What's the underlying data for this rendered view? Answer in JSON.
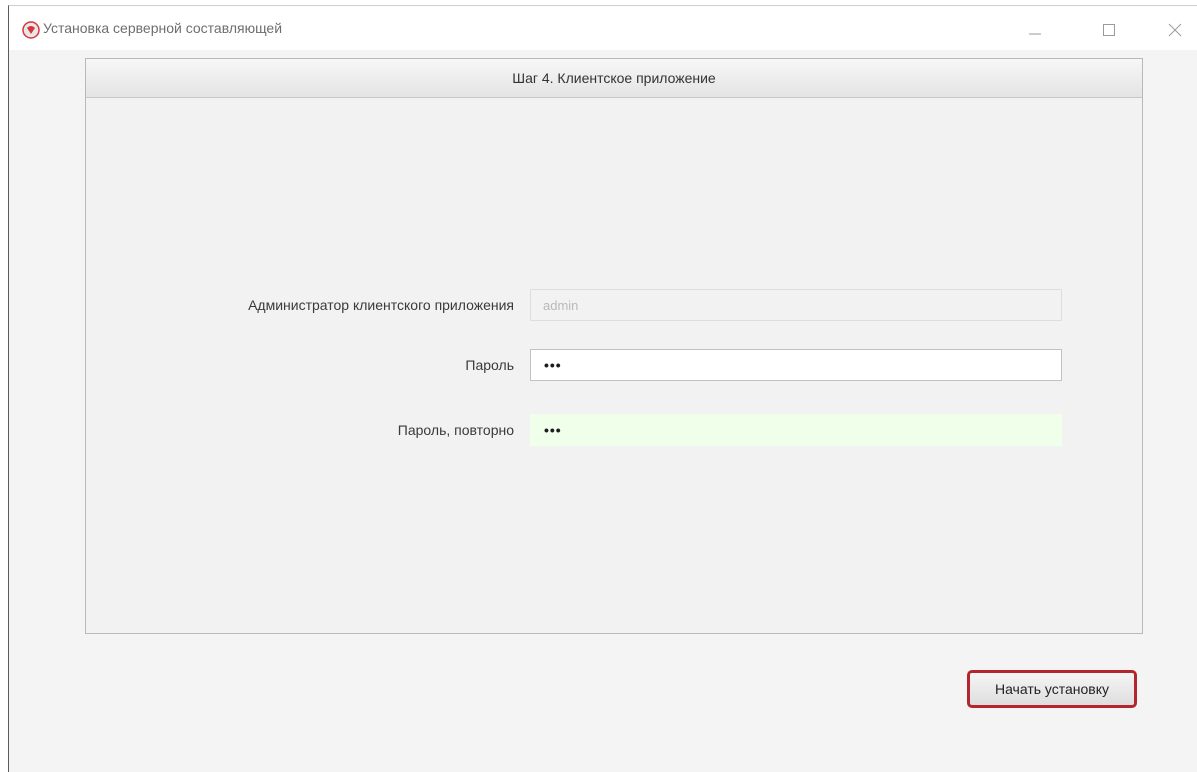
{
  "window": {
    "title": "Установка серверной составляющей",
    "controls": [
      "minimize-icon",
      "maximize-icon",
      "close-icon"
    ]
  },
  "panel": {
    "header": "Шаг 4. Клиентское приложение"
  },
  "form": {
    "admin": {
      "label": "Администратор клиентского приложения",
      "value": "admin",
      "disabled": true
    },
    "password": {
      "label": "Пароль",
      "masked": "•••"
    },
    "password_repeat": {
      "label": "Пароль, повторно",
      "masked": "•••"
    }
  },
  "buttons": {
    "start_install": "Начать установку"
  },
  "colors": {
    "accent_border": "#b3262d",
    "valid_bg": "#efffea",
    "app_icon": "#d8363c"
  }
}
